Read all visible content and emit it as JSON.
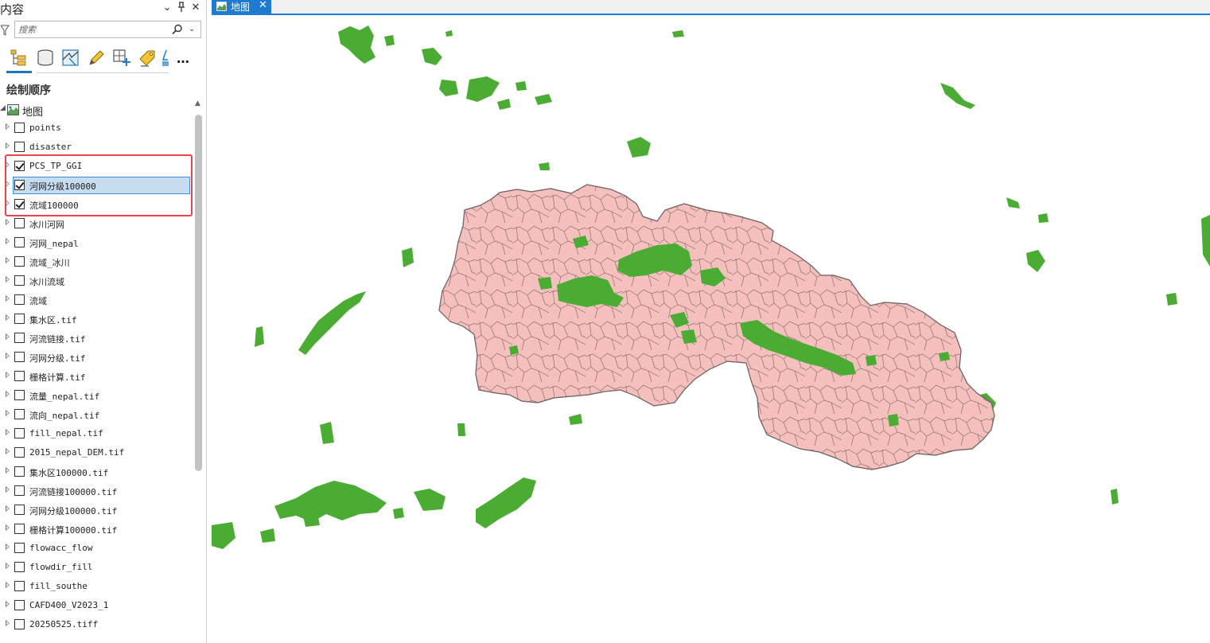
{
  "pane": {
    "title": "内容",
    "title_buttons": {
      "dropdown": "⌄",
      "pin": "⊓",
      "close": "✕"
    },
    "search": {
      "placeholder": "搜索",
      "value": ""
    },
    "toolbar": [
      "list-by-drawing-order",
      "list-by-source",
      "list-by-selection",
      "list-by-editing",
      "list-by-snapping",
      "list-by-labeling",
      "list-by-charts"
    ],
    "toolbar_more": "…",
    "section_title": "绘制顺序",
    "map_node": "地图",
    "layers": [
      {
        "name": "points",
        "checked": false
      },
      {
        "name": "disaster",
        "checked": false
      },
      {
        "name": "PCS_TP_GGI",
        "checked": true
      },
      {
        "name": "河网分级100000",
        "checked": true,
        "selected": true
      },
      {
        "name": "流域100000",
        "checked": true
      },
      {
        "name": "冰川河网",
        "checked": false
      },
      {
        "name": "河网_nepal",
        "checked": false
      },
      {
        "name": "流域_冰川",
        "checked": false
      },
      {
        "name": "冰川流域",
        "checked": false
      },
      {
        "name": "流域",
        "checked": false
      },
      {
        "name": "集水区.tif",
        "checked": false
      },
      {
        "name": "河流链接.tif",
        "checked": false
      },
      {
        "name": "河网分级.tif",
        "checked": false
      },
      {
        "name": "栅格计算.tif",
        "checked": false
      },
      {
        "name": "流量_nepal.tif",
        "checked": false
      },
      {
        "name": "流向_nepal.tif",
        "checked": false
      },
      {
        "name": "fill_nepal.tif",
        "checked": false
      },
      {
        "name": "2015_nepal_DEM.tif",
        "checked": false
      },
      {
        "name": "集水区100000.tif",
        "checked": false
      },
      {
        "name": "河流链接100000.tif",
        "checked": false
      },
      {
        "name": "河网分级100000.tif",
        "checked": false
      },
      {
        "name": "栅格计算100000.tif",
        "checked": false
      },
      {
        "name": "flowacc_flow",
        "checked": false
      },
      {
        "name": "flowdir_fill",
        "checked": false
      },
      {
        "name": "fill_southe",
        "checked": false
      },
      {
        "name": "CAFD400_V2023_1",
        "checked": false
      },
      {
        "name": "20250525.tiff",
        "checked": false
      }
    ]
  },
  "map_tab": {
    "label": "地图",
    "close": "✕"
  },
  "colors": {
    "accent": "#1e7bd1",
    "highlight_box": "#e8434b",
    "basin_fill": "#f4bfbd",
    "river_stroke": "#5f8f85",
    "glacier_green": "#4aac33"
  }
}
